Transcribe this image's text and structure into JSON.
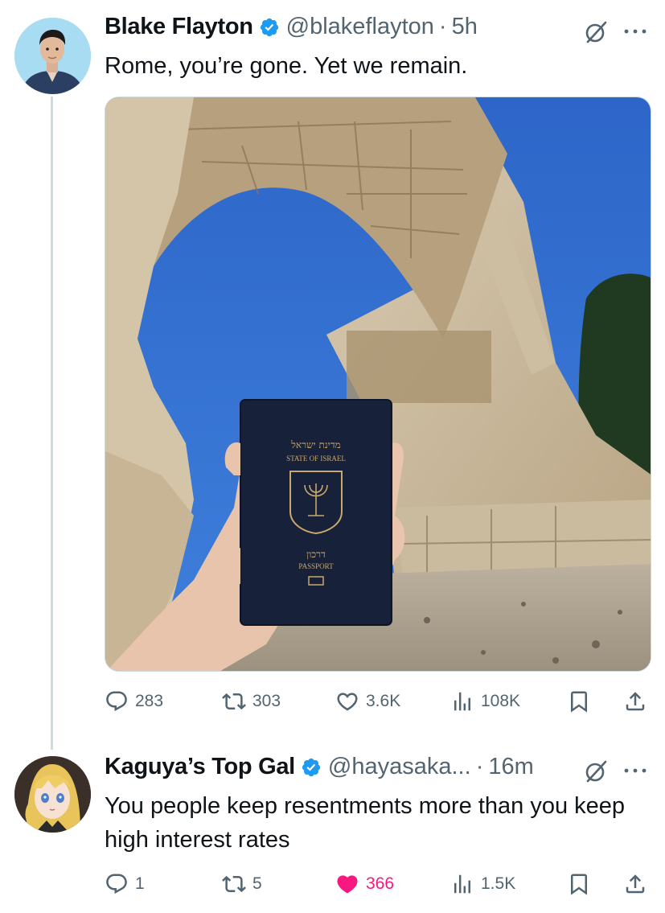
{
  "tweet": {
    "author": "Blake Flayton",
    "handle": "@blakeflayton",
    "separator": "·",
    "time": "5h",
    "text": "Rome, you’re gone. Yet we remain.",
    "photo": {
      "passport": {
        "hebrew_title": "מדינת ישראל",
        "english_title": "STATE OF ISRAEL",
        "hebrew_label": "דרכון",
        "english_label": "PASSPORT"
      }
    },
    "metrics": {
      "replies": "283",
      "reposts": "303",
      "likes": "3.6K",
      "views": "108K"
    }
  },
  "reply": {
    "author": "Kaguya’s Top Gal",
    "handle": "@hayasaka...",
    "separator": "·",
    "time": "16m",
    "text": "You people keep resentments more than you keep high interest rates",
    "metrics": {
      "replies": "1",
      "reposts": "5",
      "likes": "366",
      "views": "1.5K"
    }
  },
  "colors": {
    "verified_blue": "#1d9bf0",
    "like_pink": "#f91880",
    "secondary_text": "#536471",
    "thread_line": "#cfd9de"
  },
  "icons": [
    "verified-icon",
    "grok-icon",
    "more-icon",
    "reply-icon",
    "repost-icon",
    "like-icon",
    "views-icon",
    "bookmark-icon",
    "share-icon"
  ]
}
